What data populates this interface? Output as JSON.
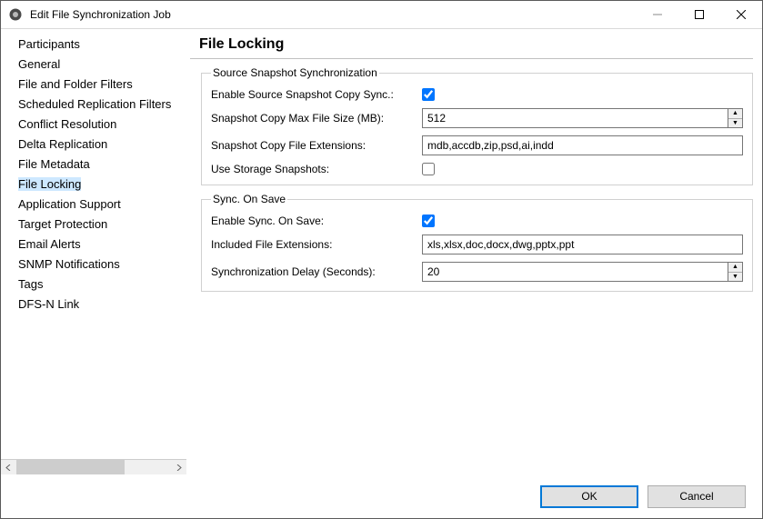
{
  "window": {
    "title": "Edit File Synchronization Job"
  },
  "sidebar": {
    "items": [
      {
        "label": "Participants"
      },
      {
        "label": "General"
      },
      {
        "label": "File and Folder Filters"
      },
      {
        "label": "Scheduled Replication Filters"
      },
      {
        "label": "Conflict Resolution"
      },
      {
        "label": "Delta Replication"
      },
      {
        "label": "File Metadata"
      },
      {
        "label": "File Locking",
        "selected": true
      },
      {
        "label": "Application Support"
      },
      {
        "label": "Target Protection"
      },
      {
        "label": "Email Alerts"
      },
      {
        "label": "SNMP Notifications"
      },
      {
        "label": "Tags"
      },
      {
        "label": "DFS-N Link"
      }
    ]
  },
  "content": {
    "title": "File Locking",
    "group1": {
      "legend": "Source Snapshot Synchronization",
      "enable_label": "Enable Source Snapshot Copy Sync.:",
      "enable_value": true,
      "max_size_label": "Snapshot Copy Max File Size (MB):",
      "max_size_value": "512",
      "ext_label": "Snapshot Copy File Extensions:",
      "ext_value": "mdb,accdb,zip,psd,ai,indd",
      "storage_label": "Use Storage Snapshots:",
      "storage_value": false
    },
    "group2": {
      "legend": "Sync. On Save",
      "enable_label": "Enable Sync. On Save:",
      "enable_value": true,
      "ext_label": "Included File Extensions:",
      "ext_value": "xls,xlsx,doc,docx,dwg,pptx,ppt",
      "delay_label": "Synchronization Delay (Seconds):",
      "delay_value": "20"
    }
  },
  "footer": {
    "ok": "OK",
    "cancel": "Cancel"
  }
}
